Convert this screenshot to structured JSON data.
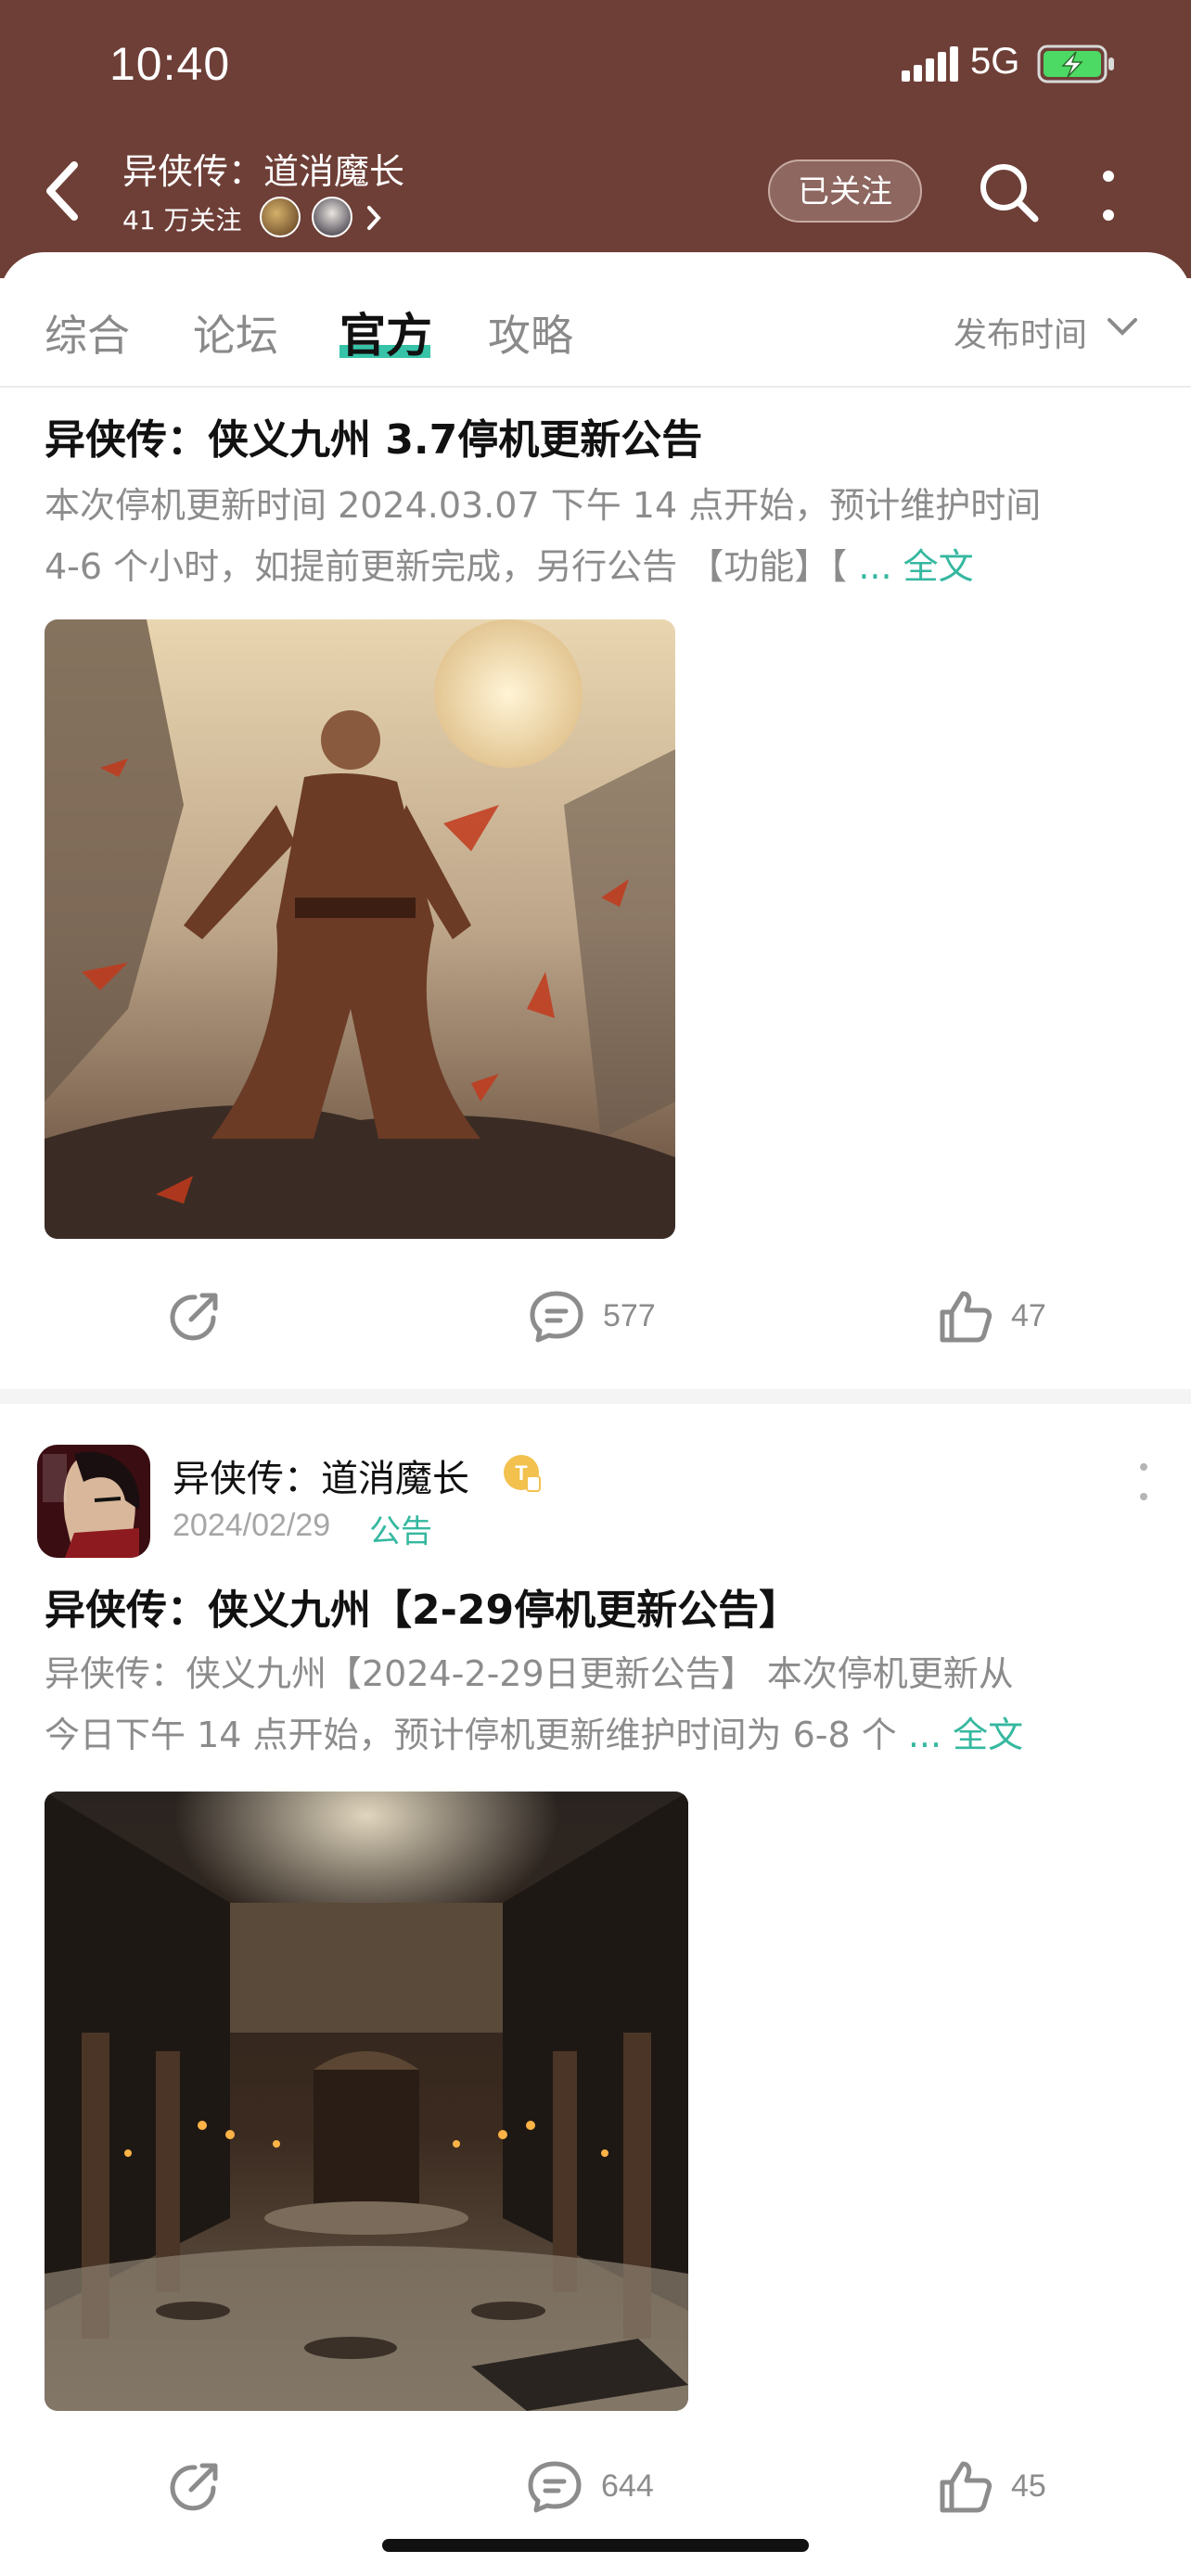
{
  "status_bar": {
    "time": "10:40",
    "network": "5G"
  },
  "header": {
    "forum_title": "异侠传：道消魔长",
    "followers": "41 万关注",
    "follow_label": "已关注"
  },
  "tabs": [
    {
      "label": "综合"
    },
    {
      "label": "论坛"
    },
    {
      "label": "官方"
    },
    {
      "label": "攻略"
    }
  ],
  "active_tab": "官方",
  "sort": {
    "label": "发布时间"
  },
  "posts": [
    {
      "title": "异侠传：侠义九州 3.7停机更新公告",
      "excerpt_line1": "本次停机更新时间 2024.03.07 下午 14 点开始，预计维护时间",
      "excerpt_line2": "4-6 个小时，如提前更新完成，另行公告 【功能】【",
      "read_more": " ... 全文",
      "share_icon": "share-icon",
      "comments": "577",
      "likes": "47"
    },
    {
      "author": "异侠传：道消魔长",
      "date": "2024/02/29",
      "tag": "公告",
      "title": "异侠传：侠义九州【2-29停机更新公告】",
      "excerpt_line1": "异侠传：侠义九州【2024-2-29日更新公告】 本次停机更新从",
      "excerpt_line2": "今日下午 14 点开始，预计停机更新维护时间为 6-8 个",
      "read_more": " ... 全文",
      "share_icon": "share-icon",
      "comments": "644",
      "likes": "45"
    }
  ],
  "colors": {
    "header_bg": "#6e3f37",
    "accent": "#36c3a8",
    "link": "#36b8a0"
  }
}
